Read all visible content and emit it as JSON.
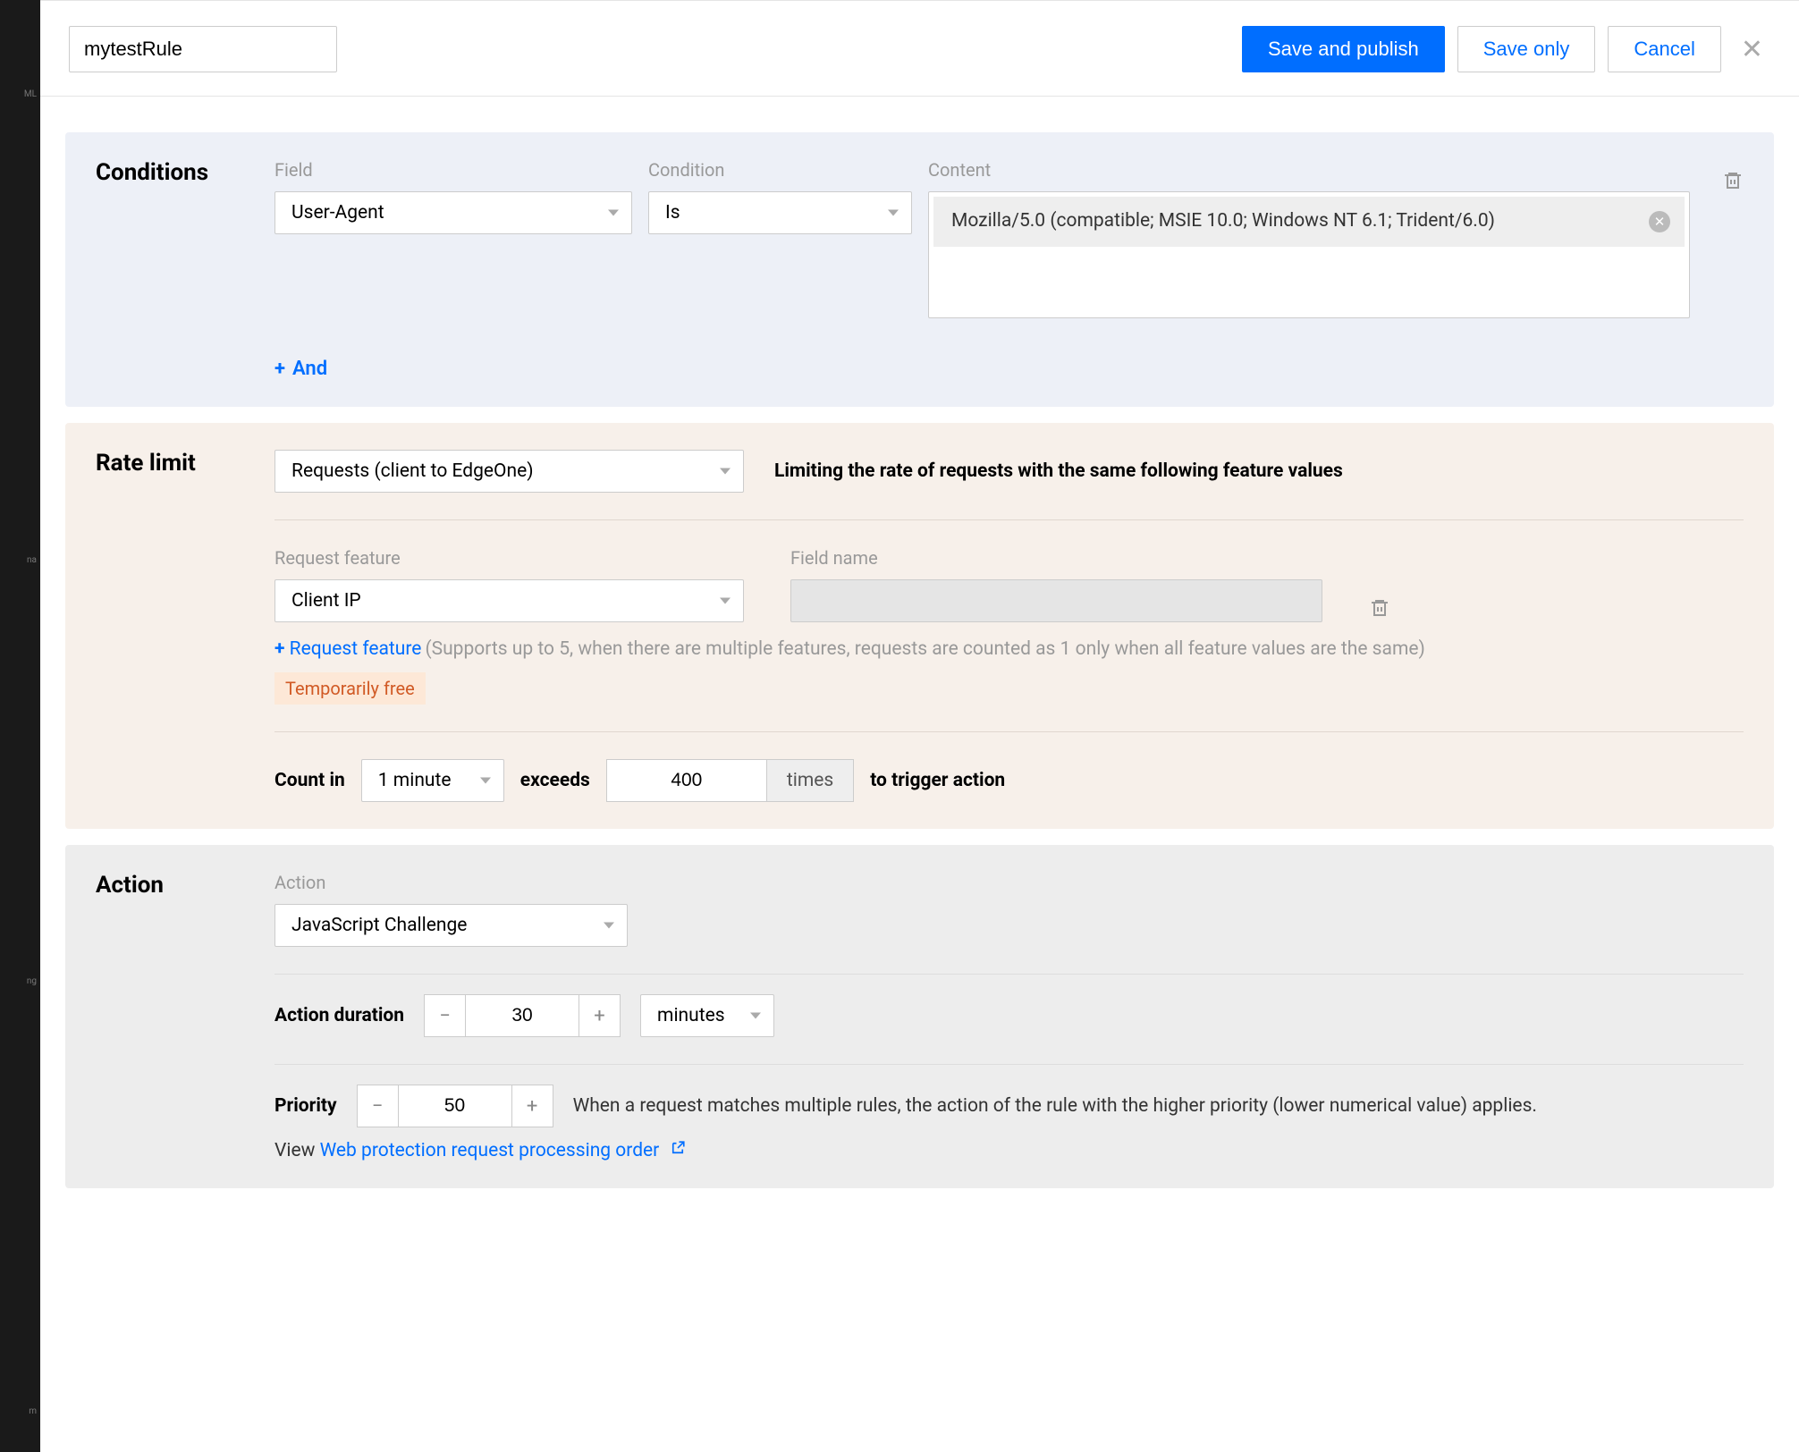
{
  "header": {
    "rule_name": "mytestRule",
    "save_publish": "Save and publish",
    "save_only": "Save only",
    "cancel": "Cancel"
  },
  "conditions": {
    "title": "Conditions",
    "field_label": "Field",
    "field_value": "User-Agent",
    "condition_label": "Condition",
    "condition_value": "Is",
    "content_label": "Content",
    "content_value": "Mozilla/5.0 (compatible; MSIE 10.0; Windows NT 6.1; Trident/6.0)",
    "and_label": "And"
  },
  "rate": {
    "title": "Rate limit",
    "scope_value": "Requests (client to EdgeOne)",
    "scope_desc": "Limiting the rate of requests with the same following feature values",
    "feature_label": "Request feature",
    "feature_value": "Client IP",
    "fieldname_label": "Field name",
    "add_feature": "Request feature",
    "add_feature_note": "(Supports up to 5, when there are multiple features, requests are counted as 1 only when all feature values are the same)",
    "temp_free": "Temporarily free",
    "count_in_label": "Count in",
    "count_in_value": "1 minute",
    "exceeds_label": "exceeds",
    "exceeds_value": "400",
    "times_label": "times",
    "trigger_label": "to trigger action"
  },
  "action": {
    "title": "Action",
    "action_label": "Action",
    "action_value": "JavaScript Challenge",
    "duration_label": "Action duration",
    "duration_value": "30",
    "duration_unit": "minutes",
    "priority_label": "Priority",
    "priority_value": "50",
    "priority_note": "When a request matches multiple rules, the action of the rule with the higher priority (lower numerical value) applies.",
    "view_label": "View ",
    "view_link": "Web protection request processing order"
  }
}
